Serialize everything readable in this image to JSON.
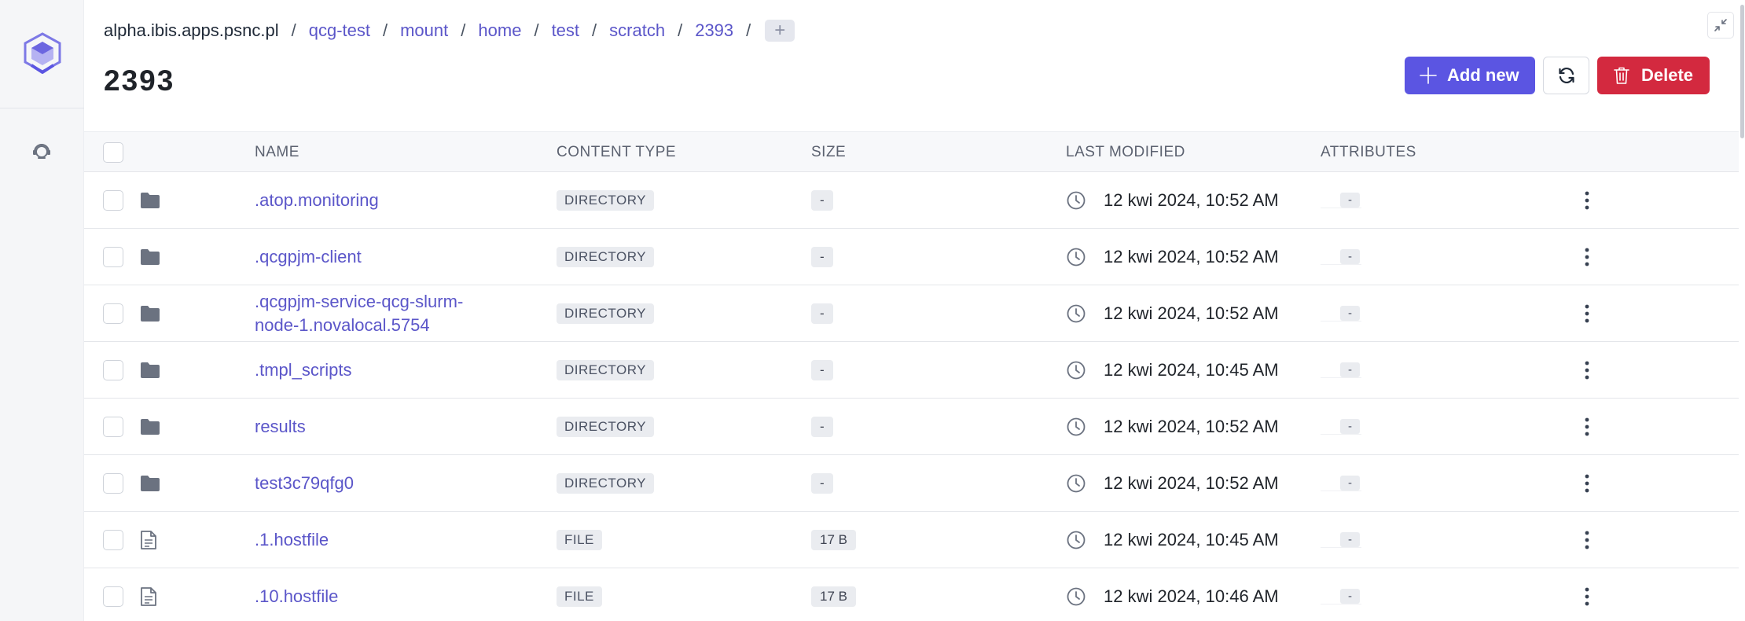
{
  "breadcrumb": [
    {
      "label": "alpha.ibis.apps.psnc.pl"
    },
    {
      "label": "qcg-test"
    },
    {
      "label": "mount"
    },
    {
      "label": "home"
    },
    {
      "label": "test"
    },
    {
      "label": "scratch"
    },
    {
      "label": "2393"
    }
  ],
  "breadcrumb_separator": "/",
  "breadcrumb_add_icon": "+",
  "page_title": "2393",
  "actions": {
    "add_label": "Add new",
    "delete_label": "Delete"
  },
  "table": {
    "headers": {
      "name": "NAME",
      "content_type": "CONTENT TYPE",
      "size": "SIZE",
      "last_modified": "LAST MODIFIED",
      "attributes": "ATTRIBUTES"
    },
    "rows": [
      {
        "icon": "folder-icon",
        "name_lines": [
          ".atop.monitoring"
        ],
        "type": "DIRECTORY",
        "size": "-",
        "modified": "12 kwi 2024, 10:52 AM",
        "attributes": "-"
      },
      {
        "icon": "folder-icon",
        "name_lines": [
          ".qcgpjm-client"
        ],
        "type": "DIRECTORY",
        "size": "-",
        "modified": "12 kwi 2024, 10:52 AM",
        "attributes": "-"
      },
      {
        "icon": "folder-icon",
        "name_lines": [
          ".qcgpjm-service-qcg-slurm-",
          "node-1.novalocal.5754"
        ],
        "type": "DIRECTORY",
        "size": "-",
        "modified": "12 kwi 2024, 10:52 AM",
        "attributes": "-"
      },
      {
        "icon": "folder-icon",
        "name_lines": [
          ".tmpl_scripts"
        ],
        "type": "DIRECTORY",
        "size": "-",
        "modified": "12 kwi 2024, 10:45 AM",
        "attributes": "-"
      },
      {
        "icon": "folder-icon",
        "name_lines": [
          "results"
        ],
        "type": "DIRECTORY",
        "size": "-",
        "modified": "12 kwi 2024, 10:52 AM",
        "attributes": "-"
      },
      {
        "icon": "folder-icon",
        "name_lines": [
          "test3c79qfg0"
        ],
        "type": "DIRECTORY",
        "size": "-",
        "modified": "12 kwi 2024, 10:52 AM",
        "attributes": "-"
      },
      {
        "icon": "file-icon",
        "name_lines": [
          ".1.hostfile"
        ],
        "type": "FILE",
        "size": "17 B",
        "modified": "12 kwi 2024, 10:45 AM",
        "attributes": "-"
      },
      {
        "icon": "file-icon",
        "name_lines": [
          ".10.hostfile"
        ],
        "type": "FILE",
        "size": "17 B",
        "modified": "12 kwi 2024, 10:46 AM",
        "attributes": "-"
      }
    ]
  },
  "colors": {
    "accent": "#5b55e2",
    "link": "#5b56c9",
    "danger": "#d3293f",
    "sidebar_bg": "#f5f6f8"
  }
}
